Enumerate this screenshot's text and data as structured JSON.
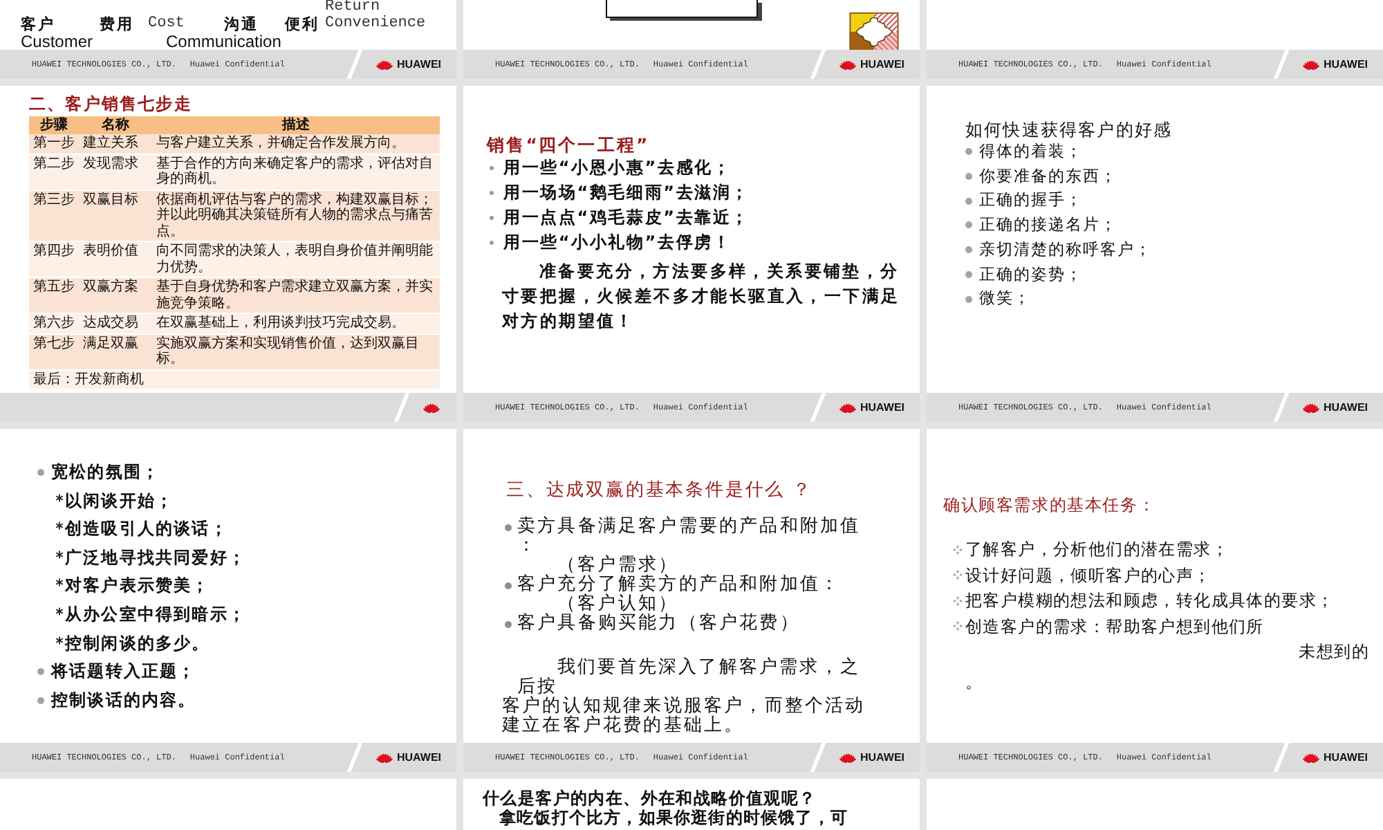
{
  "slides": [
    {
      "kind": "terms",
      "lines": [
        [
          {
            "text": "Return",
            "kind": "mono"
          }
        ],
        [
          {
            "text": "客户",
            "kind": "label"
          },
          {
            "text": "费用",
            "kind": "label"
          },
          {
            "text": "Cost",
            "kind": "mono"
          },
          {
            "text": "沟通",
            "kind": "label"
          },
          {
            "text": "便利",
            "kind": "label"
          },
          {
            "text": "Convenience",
            "kind": "mono"
          }
        ],
        [
          {
            "text": "Customer",
            "kind": "sans"
          },
          {
            "text": "Communication",
            "kind": "sans"
          }
        ]
      ],
      "footer": {
        "company": "HUAWEI TECHNOLOGIES CO., LTD.",
        "confidential": "Huawei Confidential",
        "logo": true,
        "brand": "HUAWEI"
      }
    },
    {
      "kind": "frame",
      "footer": {
        "company": "HUAWEI TECHNOLOGIES CO., LTD.",
        "confidential": "Huawei Confidential",
        "logo": true,
        "brand": "HUAWEI"
      }
    },
    {
      "kind": "blank",
      "footer": {
        "company": "HUAWEI TECHNOLOGIES CO., LTD.",
        "confidential": "Huawei Confidential",
        "logo": true,
        "brand": "HUAWEI"
      }
    },
    {
      "kind": "table",
      "title": "二、客户销售七步走",
      "table": {
        "columns": [
          "步骤",
          "名称",
          "描述"
        ],
        "rows": [
          [
            "第一步",
            "建立关系",
            "与客户建立关系，并确定合作发展方向。"
          ],
          [
            "第二步",
            "发现需求",
            "基于合作的方向来确定客户的需求，评估对自身的商机。"
          ],
          [
            "第三步",
            "双赢目标",
            "依据商机评估与客户的需求，构建双赢目标；并以此明确其决策链所有人物的需求点与痛苦点。"
          ],
          [
            "第四步",
            "表明价值",
            "向不同需求的决策人，表明自身价值并阐明能力优势。"
          ],
          [
            "第五步",
            "双赢方案",
            "基于自身优势和客户需求建立双赢方案，并实施竞争策略。"
          ],
          [
            "第六步",
            "达成交易",
            "在双赢基础上，利用谈判技巧完成交易。"
          ],
          [
            "第七步",
            "满足双赢",
            "实施双赢方案和实现销售价值，达到双赢目标。"
          ]
        ],
        "closing": "最后：开发新商机"
      },
      "footer": {
        "logo": true
      }
    },
    {
      "kind": "tips",
      "title": "销售“四个一工程”",
      "items": [
        "用一些“小恩小惠”去感化；",
        "用一场场“鹅毛细雨”去滋润；",
        "用一点点“鸡毛蒜皮”去靠近；",
        "用一些“小小礼物”去俘虏！"
      ],
      "paragraph": "准备要充分，方法要多样，关系要铺垫，分寸要把握，火候差不多才能长驱直入，一下满足对方的期望值！",
      "footer": {
        "company": "HUAWEI TECHNOLOGIES CO., LTD.",
        "confidential": "Huawei Confidential",
        "logo": true,
        "brand": "HUAWEI"
      }
    },
    {
      "kind": "list",
      "title": "如何快速获得客户的好感",
      "items": [
        "得体的着装；",
        "你要准备的东西；",
        "正确的握手；",
        "正确的接递名片；",
        "亲切清楚的称呼客户；",
        "正确的姿势；",
        "微笑；"
      ],
      "footer": {
        "company": "HUAWEI TECHNOLOGIES CO., LTD.",
        "confidential": "Huawei Confidential",
        "logo": true,
        "brand": "HUAWEI"
      }
    },
    {
      "kind": "outline",
      "items": [
        {
          "text": "宽松的氛围；",
          "children": [
            {
              "text": "以闲谈开始；"
            },
            {
              "text": "创造吸引人的谈话；"
            },
            {
              "text": "广泛地寻找共同爱好；"
            },
            {
              "text": "对客户表示赞美；"
            },
            {
              "text": "从办公室中得到暗示；"
            },
            {
              "text": "控制闲谈的多少。"
            }
          ]
        },
        {
          "text": "将话题转入正题；"
        },
        {
          "text": "控制谈话的内容。"
        }
      ],
      "footer": {
        "company": "HUAWEI TECHNOLOGIES CO., LTD.",
        "confidential": "Huawei Confidential",
        "logo": true,
        "brand": "HUAWEI"
      }
    },
    {
      "kind": "conditions",
      "title": "三、达成双赢的基本条件是什么 ？",
      "items": [
        {
          "text": "卖方具备满足客户需要的产品和附加值：",
          "note": "（客户需求）"
        },
        {
          "text": "客户充分了解卖方的产品和附加值：",
          "note": "（客户认知）"
        },
        {
          "text": "客户具备购买能力（客户花费）"
        }
      ],
      "paragraphs": [
        "我们要首先深入了解客户需求，之后按",
        "客户的认知规律来说服客户，而整个活动建立在客户花费的基础上。"
      ],
      "footer": {
        "company": "HUAWEI TECHNOLOGIES CO., LTD.",
        "confidential": "Huawei Confidential",
        "logo": true,
        "brand": "HUAWEI"
      }
    },
    {
      "kind": "tasks",
      "title": "确认顾客需求的基本任务：",
      "items": [
        "了解客户，分析他们的潜在需求；",
        "设计好问题，倾听客户的心声；",
        "把客户模糊的想法和顾虑，转化成具体的要求；",
        "创造客户的需求：帮助客户想到他们所"
      ],
      "tail": "未想到的",
      "end": "。",
      "footer": {
        "company": "HUAWEI TECHNOLOGIES CO., LTD.",
        "confidential": "Huawei Confidential",
        "logo": true,
        "brand": "HUAWEI"
      }
    },
    {
      "kind": "blank"
    },
    {
      "kind": "text",
      "title": "什么是客户的内在、外在和战略价值观呢？",
      "paragraph": "拿吃饭打个比方，如果你逛街的时候饿了，可"
    },
    {
      "kind": "blank"
    }
  ]
}
